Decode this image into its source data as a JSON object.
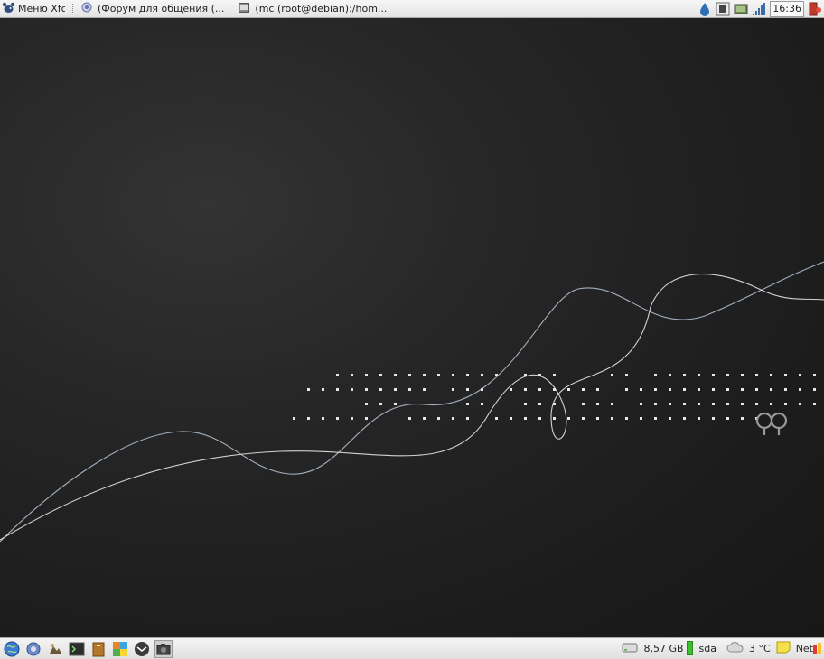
{
  "top_panel": {
    "menu_label": "Меню Xfce",
    "tasks": [
      {
        "label": "(Форум для общения (..."
      },
      {
        "label": "(mc (root@debian):/hom..."
      }
    ],
    "clock": "16:36"
  },
  "desktop": {
    "wallpaper_colors": {
      "bg": "#1c1c1c",
      "dots": "#e8e8e8",
      "line_white": "#e6e6e6",
      "line_blue": "#b8c8d8"
    }
  },
  "bottom_panel": {
    "launchers": [
      {
        "name": "globe-icon"
      },
      {
        "name": "network-settings-icon"
      },
      {
        "name": "image-editor-icon"
      },
      {
        "name": "terminal-icon"
      },
      {
        "name": "archive-icon"
      },
      {
        "name": "applications-icon"
      },
      {
        "name": "email-icon"
      },
      {
        "name": "screenshot-icon"
      }
    ],
    "disk_free": "8,57 GB",
    "disk_name": "sda",
    "temperature": "3 °C",
    "net_label": "Net"
  }
}
